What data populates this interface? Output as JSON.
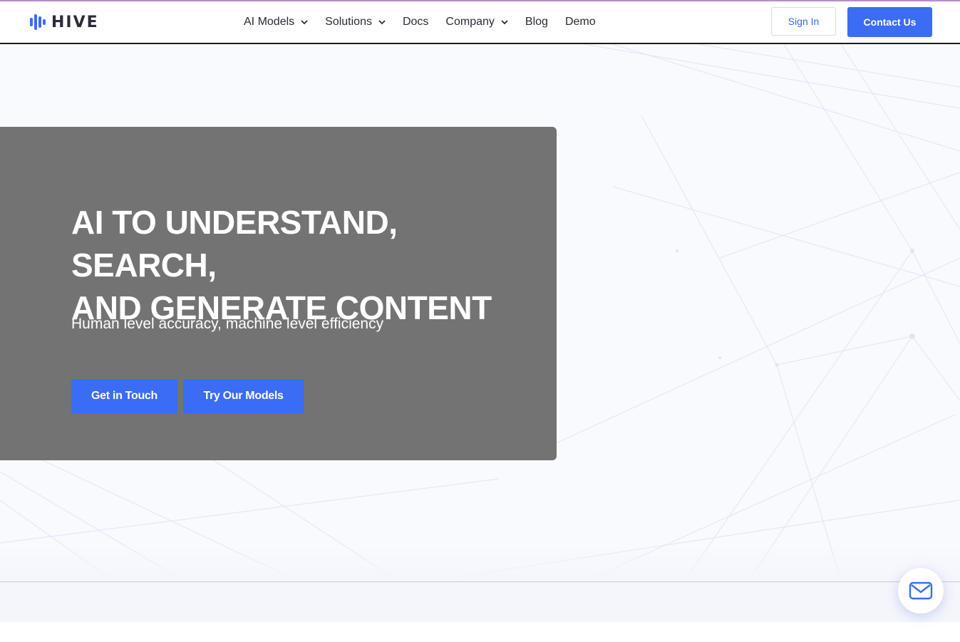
{
  "brand": {
    "name": "HIVE",
    "accent": "#3a6cf4",
    "logo_icon": "hive-bars-icon"
  },
  "nav": {
    "items": [
      {
        "label": "AI Models",
        "has_dropdown": true
      },
      {
        "label": "Solutions",
        "has_dropdown": true
      },
      {
        "label": "Docs",
        "has_dropdown": false
      },
      {
        "label": "Company",
        "has_dropdown": true
      },
      {
        "label": "Blog",
        "has_dropdown": false
      },
      {
        "label": "Demo",
        "has_dropdown": false
      }
    ],
    "sign_in_label": "Sign In",
    "contact_label": "Contact Us"
  },
  "hero": {
    "title_line1": "AI TO UNDERSTAND, SEARCH,",
    "title_line2": "AND GENERATE CONTENT",
    "subtitle": "Human level accuracy, machine level efficiency",
    "primary_button": "Get in Touch",
    "secondary_button": "Try Our Models",
    "card_color": "#737373"
  },
  "chat_widget": {
    "icon": "mail-icon"
  }
}
